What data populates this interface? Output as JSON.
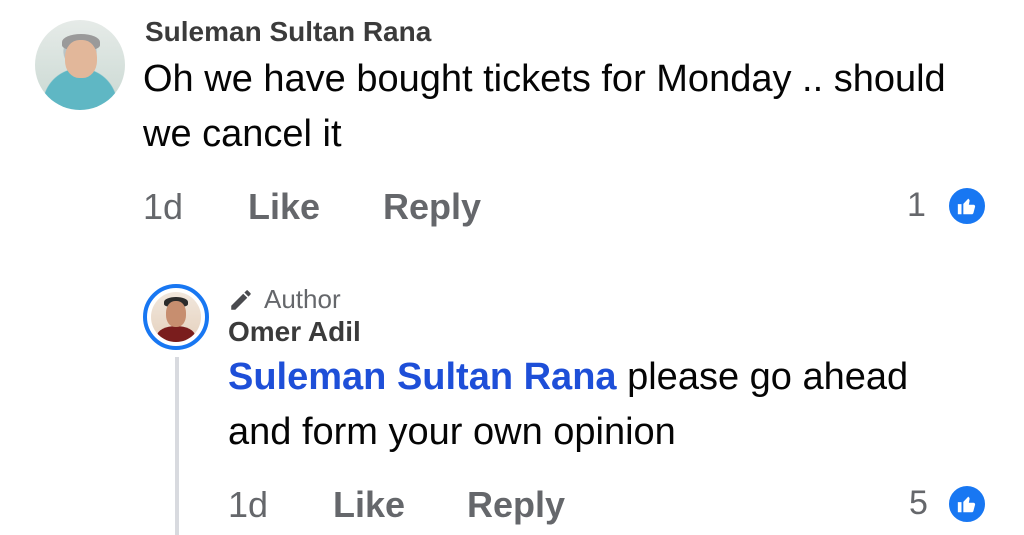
{
  "comments": [
    {
      "name": "Suleman Sultan Rana",
      "text": "Oh we have bought tickets for Monday .. should we cancel it",
      "time": "1d",
      "like_label": "Like",
      "reply_label": "Reply",
      "reaction_count": "1"
    }
  ],
  "reply": {
    "badge": "Author",
    "name": "Omer Adil",
    "mention": "Suleman Sultan Rana",
    "text": " please go ahead and form your own opinion",
    "time": "1d",
    "like_label": "Like",
    "reply_label": "Reply",
    "reaction_count": "5"
  },
  "colors": {
    "accent": "#1877f2",
    "mention": "#1e4fd8",
    "secondary_text": "#65676b"
  },
  "icons": {
    "reaction": "thumbs-up-icon",
    "author_badge": "pencil-icon"
  }
}
